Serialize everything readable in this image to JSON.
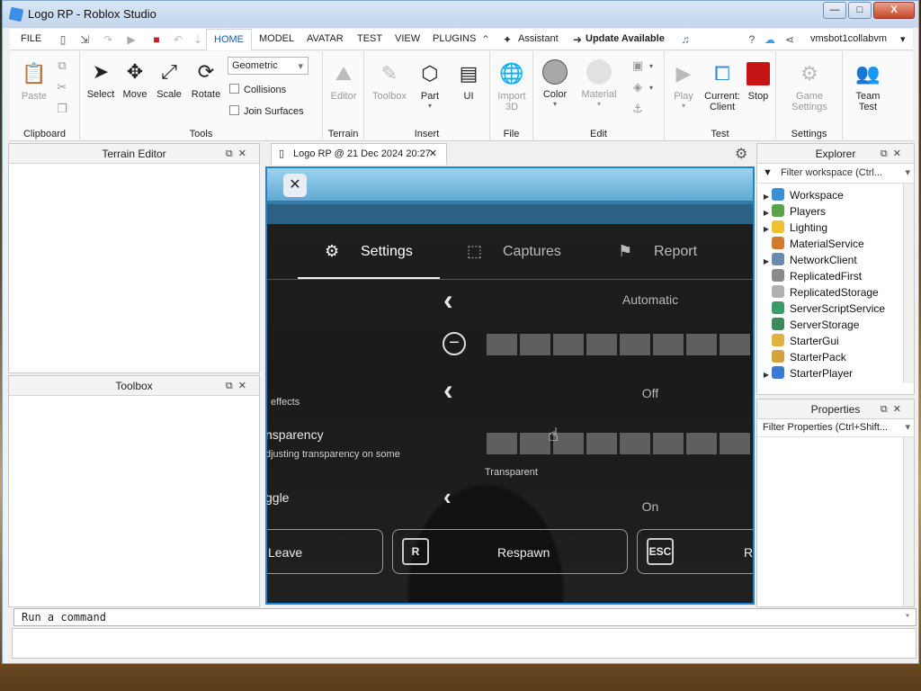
{
  "window": {
    "title": "Logo RP - Roblox Studio",
    "min": "—",
    "max": "□",
    "close": "X"
  },
  "menu": {
    "file": "FILE",
    "tabs": [
      "HOME",
      "MODEL",
      "AVATAR",
      "TEST",
      "VIEW",
      "PLUGINS"
    ],
    "assistant": "Assistant",
    "update": "Update Available",
    "user": "vmsbot1collabvm"
  },
  "ribbon": {
    "clipboard": {
      "label": "Clipboard",
      "paste": "Paste"
    },
    "tools": {
      "label": "Tools",
      "select": "Select",
      "move": "Move",
      "scale": "Scale",
      "rotate": "Rotate",
      "mode": "Geometric",
      "collisions": "Collisions",
      "join": "Join Surfaces"
    },
    "terrain": {
      "label": "Terrain",
      "editor": "Editor"
    },
    "insert": {
      "label": "Insert",
      "toolbox": "Toolbox",
      "part": "Part",
      "ui": "UI"
    },
    "file": {
      "label": "File",
      "import": "Import",
      "import2": "3D"
    },
    "edit": {
      "label": "Edit",
      "color": "Color",
      "material": "Material"
    },
    "test": {
      "label": "Test",
      "play": "Play",
      "current": "Current:",
      "client": "Client",
      "stop": "Stop"
    },
    "settings": {
      "label": "Settings",
      "game": "Game",
      "settings": "Settings"
    },
    "team": {
      "team": "Team",
      "test": "Test"
    }
  },
  "panels": {
    "terrain_editor": "Terrain Editor",
    "toolbox": "Toolbox",
    "explorer": "Explorer",
    "explorer_filter": "Filter workspace (Ctrl...",
    "properties": "Properties",
    "properties_filter": "Filter Properties (Ctrl+Shift..."
  },
  "viewport": {
    "tab": "Logo RP @ 21 Dec 2024 20:27",
    "tabs": {
      "settings": "Settings",
      "captures": "Captures",
      "report": "Report"
    },
    "rows": {
      "automatic": "Automatic",
      "off": "Off",
      "on": "On",
      "effects": "effects",
      "transparency": "nsparency",
      "transparency_sub": "djusting transparency on some",
      "transparent": "Transparent",
      "toggle": "ggle"
    },
    "buttons": {
      "leave": "Leave",
      "respawn": "Respawn",
      "respawn_key": "R",
      "esc_key": "ESC",
      "r_trunc": "R"
    }
  },
  "explorer_items": [
    {
      "name": "Workspace",
      "arrow": true,
      "color": "#3a8fd9"
    },
    {
      "name": "Players",
      "arrow": true,
      "color": "#5ba34a"
    },
    {
      "name": "Lighting",
      "arrow": true,
      "color": "#f0c030"
    },
    {
      "name": "MaterialService",
      "arrow": false,
      "color": "#d07a30"
    },
    {
      "name": "NetworkClient",
      "arrow": true,
      "color": "#6a8ab0"
    },
    {
      "name": "ReplicatedFirst",
      "arrow": false,
      "color": "#8a8a8a"
    },
    {
      "name": "ReplicatedStorage",
      "arrow": false,
      "color": "#b0b0b0"
    },
    {
      "name": "ServerScriptService",
      "arrow": false,
      "color": "#3a9a6a"
    },
    {
      "name": "ServerStorage",
      "arrow": false,
      "color": "#3a8a5a"
    },
    {
      "name": "StarterGui",
      "arrow": false,
      "color": "#e0b040"
    },
    {
      "name": "StarterPack",
      "arrow": false,
      "color": "#d4a040"
    },
    {
      "name": "StarterPlayer",
      "arrow": true,
      "color": "#3a7ad0"
    }
  ],
  "command": {
    "placeholder": "Run a command"
  }
}
